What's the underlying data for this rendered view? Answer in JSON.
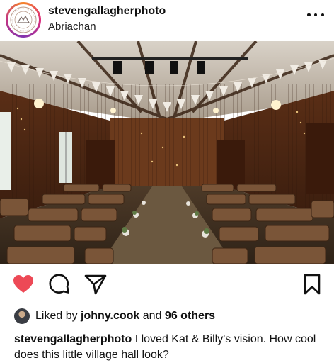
{
  "post": {
    "username": "stevengallagherphoto",
    "location": "Abriachan",
    "avatar_icon": "photographer-logo-icon",
    "image_alt": "village hall with rows of wooden chairs and bunting",
    "liked_by_prefix": "Liked by",
    "liked_by_user": "johny.cook",
    "liked_by_and": "and",
    "liked_by_others": "96 others",
    "caption_user": "stevengallagherphoto",
    "caption_text": "I loved Kat & Billy's vision. How cool does this little village hall look?"
  },
  "actions": {
    "like_icon": "heart-filled-icon",
    "comment_icon": "comment-bubble-icon",
    "share_icon": "paper-plane-icon",
    "save_icon": "bookmark-icon"
  },
  "colors": {
    "like_red": "#ed4956",
    "text": "#111111"
  }
}
